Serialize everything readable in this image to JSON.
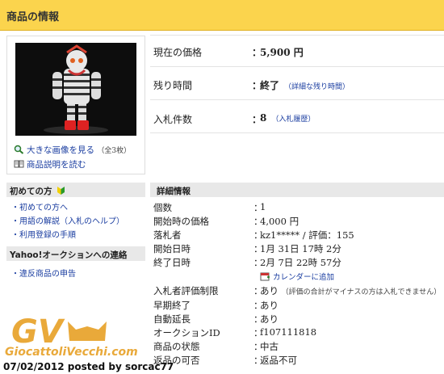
{
  "header": {
    "title": "商品の情報"
  },
  "image_panel": {
    "view_large_label": "大きな画像を見る",
    "image_count": "（全3枚）",
    "read_description_label": "商品説明を読む"
  },
  "sidebar": {
    "beginners": {
      "title": "初めての方",
      "items": [
        "初めての方へ",
        "用語の解説（入札のヘルプ）",
        "利用登録の手順"
      ]
    },
    "contact": {
      "title": "Yahoo!オークションへの連絡",
      "items": [
        "違反商品の申告"
      ]
    }
  },
  "price_panel": {
    "current_price_label": "現在の価格",
    "current_price_value": "5,900 円",
    "time_left_label": "残り時間",
    "time_left_value": "終了",
    "time_left_link": "（詳細な残り時間）",
    "bids_label": "入札件数",
    "bids_value": "8",
    "bids_link": "（入札履歴）",
    "colon": "："
  },
  "details": {
    "title": "詳細情報",
    "rows": [
      {
        "label": "個数",
        "value": "1"
      },
      {
        "label": "開始時の価格",
        "value": "4,000 円"
      },
      {
        "label": "落札者",
        "value": "kz1***** / 評価：155"
      },
      {
        "label": "開始日時",
        "value": "1月 31日 17時 2分"
      },
      {
        "label": "終了日時",
        "value": "2月 7日 22時 57分"
      },
      {
        "label": "入札者評価制限",
        "value": "あり",
        "note": "（評価の合計がマイナスの方は入札できません）"
      },
      {
        "label": "早期終了",
        "value": "あり"
      },
      {
        "label": "自動延長",
        "value": "あり"
      },
      {
        "label": "オークションID",
        "value": "f107111818"
      },
      {
        "label": "商品の状態",
        "value": "中古"
      },
      {
        "label": "返品の可否",
        "value": "返品不可"
      }
    ],
    "calendar_link": "カレンダーに追加"
  },
  "watermark": {
    "logo_text": "GV",
    "site": "GiocattoliVecchi.com",
    "caption": "07/02/2012 posted by sorcac77"
  },
  "colors": {
    "header_bg": "#fbd44d",
    "link": "#1a3da0",
    "watermark": "#e9a93a"
  }
}
